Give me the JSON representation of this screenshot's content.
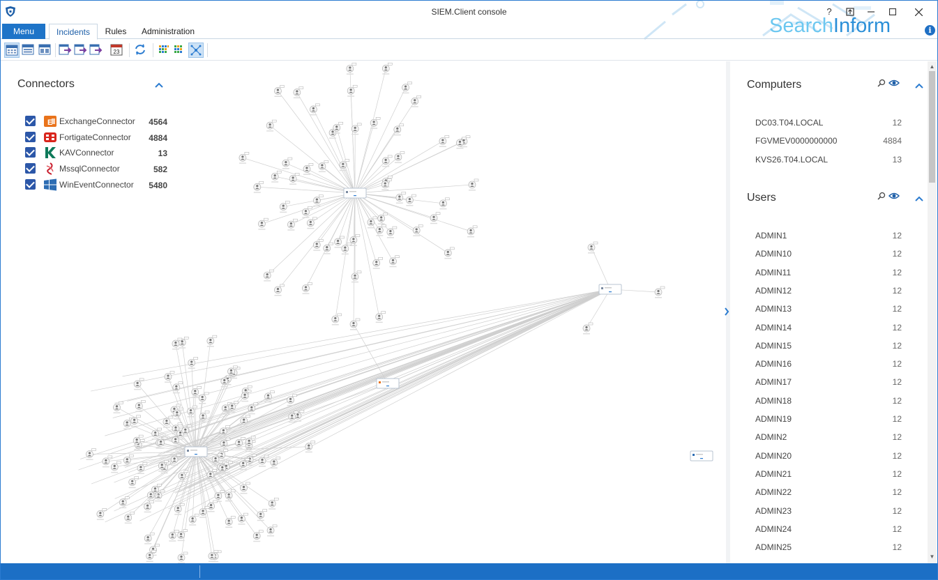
{
  "window": {
    "title": "SIEM.Client console",
    "help_label": "?",
    "brand_part1": "Search",
    "brand_part2": "Inform",
    "info_label": "i"
  },
  "tabs": {
    "menu": "Menu",
    "items": [
      "Incidents",
      "Rules",
      "Administration"
    ],
    "active": "Incidents"
  },
  "toolbar": {
    "calendar_day": "23",
    "selected_view": "graph"
  },
  "connectors": {
    "title": "Connectors",
    "items": [
      {
        "name": "ExchangeConnector",
        "count": "4564",
        "checked": true,
        "icon": "exchange-icon",
        "color": "#e9731b"
      },
      {
        "name": "FortigateConnector",
        "count": "4884",
        "checked": true,
        "icon": "fortigate-icon",
        "color": "#d9251c"
      },
      {
        "name": "KAVConnector",
        "count": "13",
        "checked": true,
        "icon": "kaspersky-icon",
        "color": "#0e7a5a"
      },
      {
        "name": "MssqlConnector",
        "count": "582",
        "checked": true,
        "icon": "mssql-icon",
        "color": "#c8202f"
      },
      {
        "name": "WinEventConnector",
        "count": "5480",
        "checked": true,
        "icon": "windows-icon",
        "color": "#2d6db3"
      }
    ]
  },
  "computers": {
    "title": "Computers",
    "items": [
      {
        "name": "DC03.T04.LOCAL",
        "count": "12"
      },
      {
        "name": "FGVMEV0000000000",
        "count": "4884"
      },
      {
        "name": "KVS26.T04.LOCAL",
        "count": "13"
      }
    ]
  },
  "users": {
    "title": "Users",
    "items": [
      {
        "name": "ADMIN1",
        "count": "12"
      },
      {
        "name": "ADMIN10",
        "count": "12"
      },
      {
        "name": "ADMIN11",
        "count": "12"
      },
      {
        "name": "ADMIN12",
        "count": "12"
      },
      {
        "name": "ADMIN13",
        "count": "12"
      },
      {
        "name": "ADMIN14",
        "count": "12"
      },
      {
        "name": "ADMIN15",
        "count": "12"
      },
      {
        "name": "ADMIN16",
        "count": "12"
      },
      {
        "name": "ADMIN17",
        "count": "12"
      },
      {
        "name": "ADMIN18",
        "count": "12"
      },
      {
        "name": "ADMIN19",
        "count": "12"
      },
      {
        "name": "ADMIN2",
        "count": "12"
      },
      {
        "name": "ADMIN20",
        "count": "12"
      },
      {
        "name": "ADMIN21",
        "count": "12"
      },
      {
        "name": "ADMIN22",
        "count": "12"
      },
      {
        "name": "ADMIN23",
        "count": "12"
      },
      {
        "name": "ADMIN24",
        "count": "12"
      },
      {
        "name": "ADMIN25",
        "count": "12"
      }
    ]
  },
  "colors": {
    "accent": "#1e74c8",
    "statusbar": "#1c6fc5",
    "checkbox": "#2c57a8",
    "brand_light": "#6cc7f0",
    "brand_dark": "#2a8fd8"
  }
}
